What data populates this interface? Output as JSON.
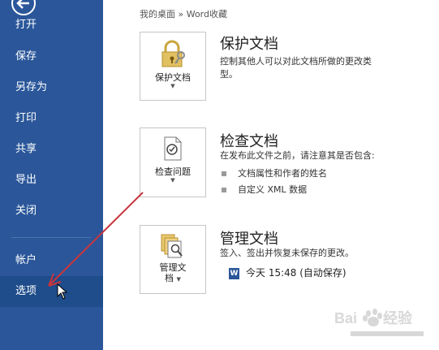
{
  "sidebar": {
    "back_icon": "back-arrow-icon",
    "items": [
      {
        "label": "打开"
      },
      {
        "label": "保存"
      },
      {
        "label": "另存为"
      },
      {
        "label": "打印"
      },
      {
        "label": "共享"
      },
      {
        "label": "导出"
      },
      {
        "label": "关闭"
      },
      {
        "label": "帐户"
      },
      {
        "label": "选项"
      }
    ],
    "active": "选项"
  },
  "breadcrumb": "我的桌面 » Word收藏",
  "protect": {
    "button_label": "保护文档",
    "title": "保护文档",
    "description_1": "控制其他人可以对此文档所做的更改类",
    "description_2": "型。"
  },
  "inspect": {
    "button_label": "检查问题",
    "title": "检查文档",
    "description": "在发布此文件之前，请注意其是否包含:",
    "bullets": [
      "文档属性和作者的姓名",
      "自定义 XML 数据"
    ]
  },
  "manage": {
    "button_label_1": "管理文",
    "button_label_2": "档",
    "title": "管理文档",
    "description": "签入、签出并恢复未保存的更改。",
    "version": "今天 15:48 (自动保存)"
  },
  "watermark": "Baidu经验",
  "colors": {
    "sidebar": "#2b579a",
    "active": "#1f4c8a",
    "arrow": "#c8353b"
  }
}
